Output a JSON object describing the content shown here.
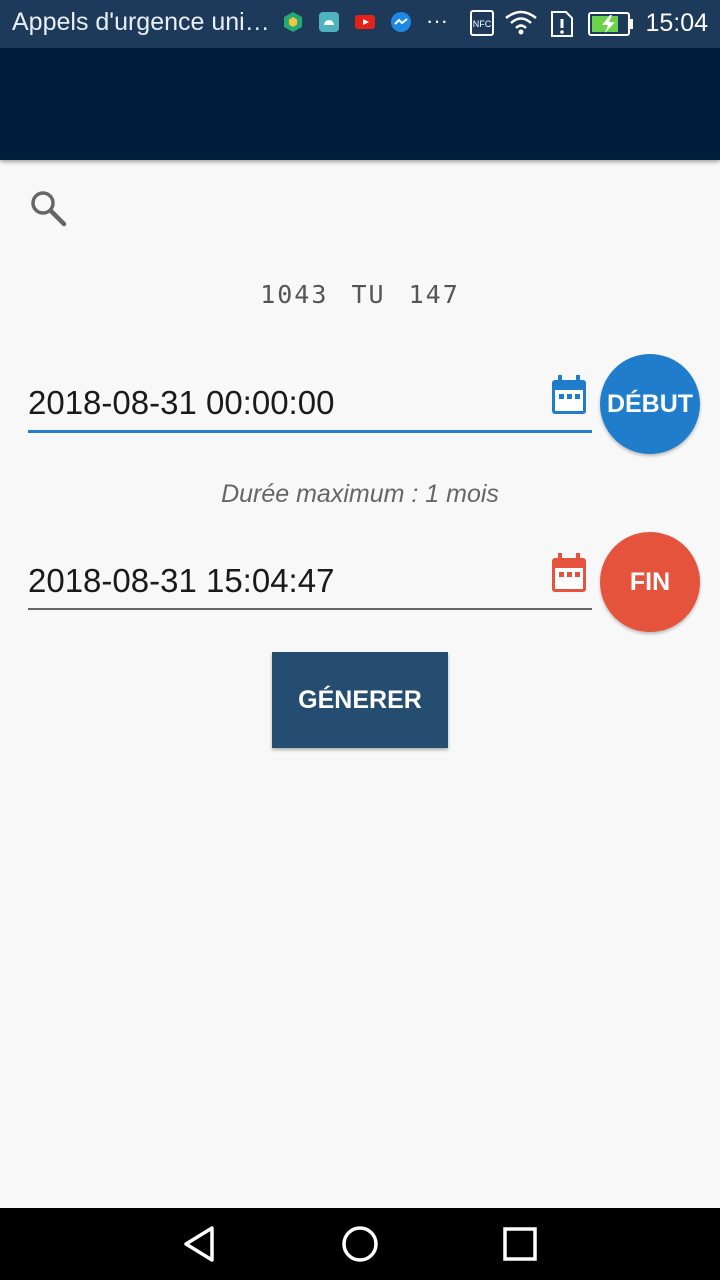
{
  "status_bar": {
    "title": "Appels d'urgence uni…",
    "more": "···",
    "nfc": "NFC",
    "time": "15:04"
  },
  "main": {
    "plate": "1043 TU 147",
    "start": {
      "value": "2018-08-31 00:00:00",
      "button": "DÉBUT"
    },
    "hint": "Durée maximum : 1 mois",
    "end": {
      "value": "2018-08-31 15:04:47",
      "button": "FIN"
    },
    "generate": "GÉNERER"
  },
  "colors": {
    "appbar": "#011d3c",
    "start": "#1f7dcb",
    "end": "#e5533c",
    "generate": "#244d71"
  },
  "icons": [
    "search-icon",
    "calendar-icon",
    "back-icon",
    "home-icon",
    "recents-icon"
  ]
}
